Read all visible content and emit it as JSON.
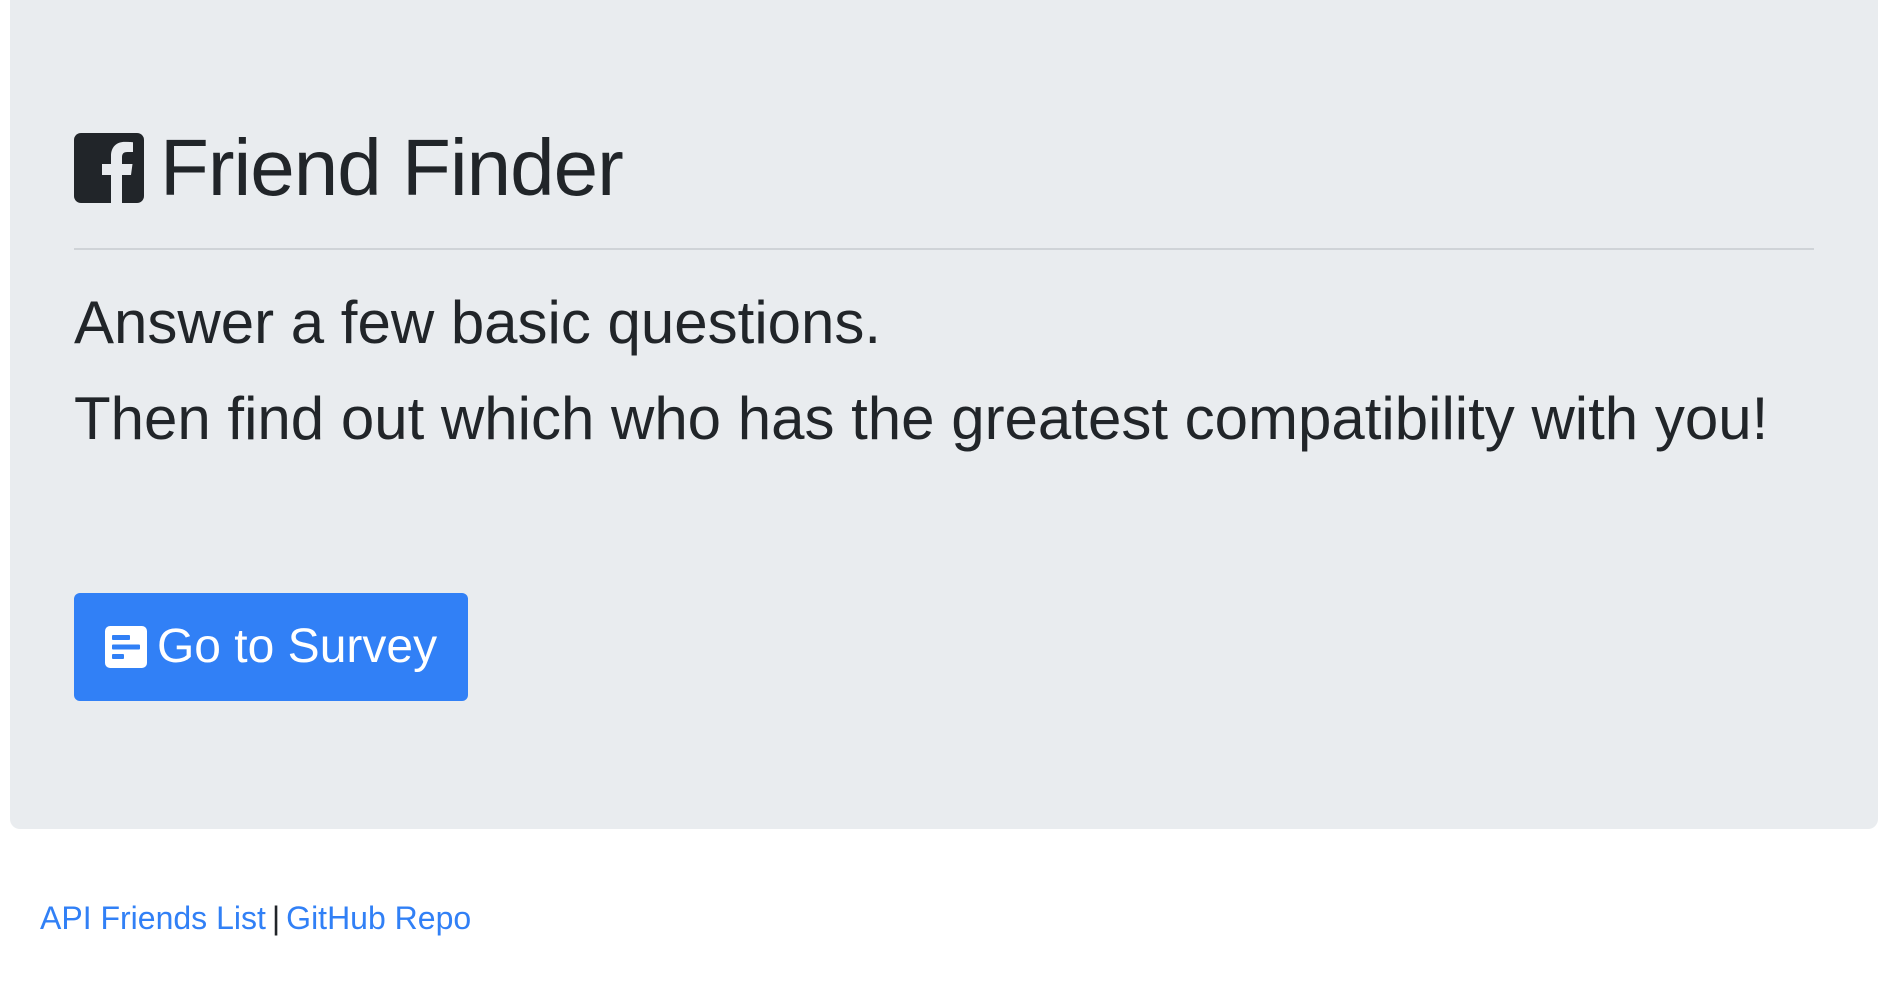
{
  "header": {
    "icon": "facebook-square-icon",
    "title": "Friend Finder"
  },
  "intro": {
    "line1": "Answer a few basic questions.",
    "line2": "Then find out which who has the greatest compatibility with you!"
  },
  "cta": {
    "icon": "file-alt-icon",
    "label": "Go to Survey"
  },
  "footer": {
    "link1": "API Friends List",
    "separator": "|",
    "link2": "GitHub Repo"
  },
  "colors": {
    "jumbotron_bg": "#e9ecef",
    "primary": "#3180f6",
    "text": "#212529",
    "link": "#3180f6"
  }
}
